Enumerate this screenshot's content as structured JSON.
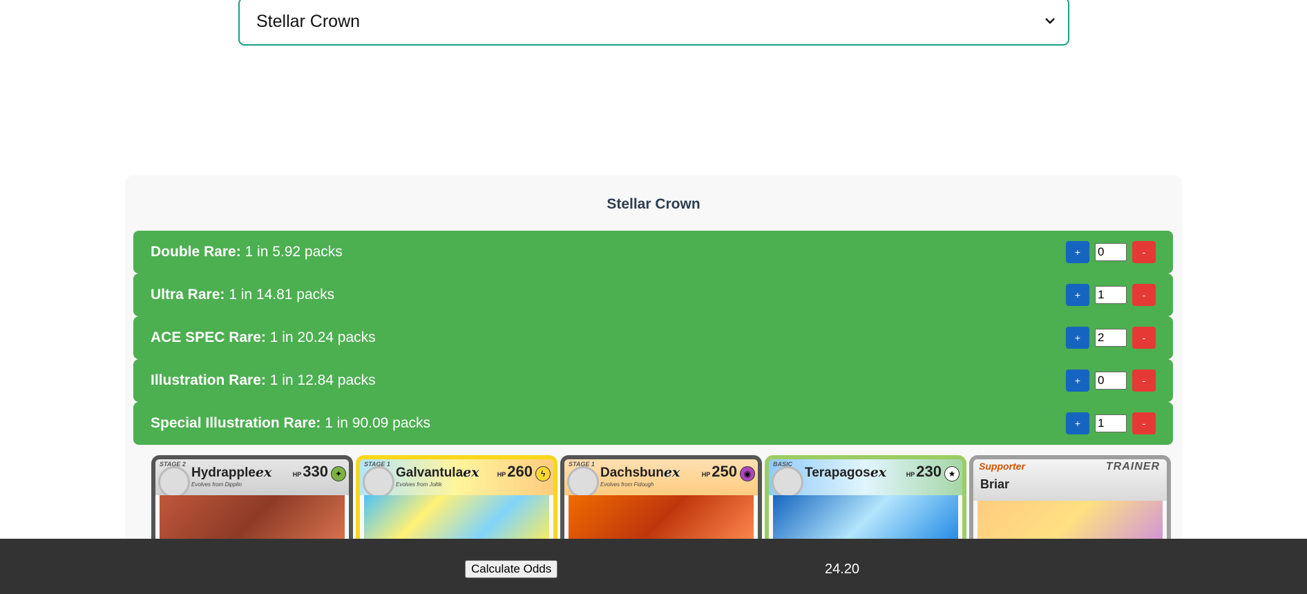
{
  "set_select": {
    "value": "Stellar Crown",
    "icon": "chevron-down-icon"
  },
  "panel": {
    "title": "Stellar Crown",
    "rarities": [
      {
        "name": "Double Rare:",
        "odds": " 1 in 5.92 packs",
        "count": "0"
      },
      {
        "name": "Ultra Rare:",
        "odds": " 1 in 14.81 packs",
        "count": "1"
      },
      {
        "name": "ACE SPEC Rare:",
        "odds": " 1 in 20.24 packs",
        "count": "2"
      },
      {
        "name": "Illustration Rare:",
        "odds": " 1 in 12.84 packs",
        "count": "0"
      },
      {
        "name": "Special Illustration Rare:",
        "odds": " 1 in 90.09 packs",
        "count": "1"
      }
    ],
    "plus_label": "+",
    "minus_label": "-"
  },
  "cards": [
    {
      "stage": "STAGE 2",
      "name": "Hydrapple",
      "suffix": "ex",
      "hp_label": "HP",
      "hp": "330",
      "evolves": "Evolves from Dipplin",
      "color": "#7cb342",
      "art": "#a5472f"
    },
    {
      "stage": "STAGE 1",
      "name": "Galvantula",
      "suffix": "ex",
      "hp_label": "HP",
      "hp": "260",
      "evolves": "Evolves from Joltik",
      "color": "#fdd835",
      "art": "#4fc3f7"
    },
    {
      "stage": "STAGE 1",
      "name": "Dachsbun",
      "suffix": "ex",
      "hp_label": "HP",
      "hp": "250",
      "evolves": "Evolves from Fidough",
      "color": "#8e24aa",
      "art": "#e65100"
    },
    {
      "stage": "BASIC",
      "name": "Terapagos",
      "suffix": "ex",
      "hp_label": "HP",
      "hp": "230",
      "evolves": "",
      "color": "#bdbdbd",
      "art": "#1e88e5"
    },
    {
      "trainer_type": "Supporter",
      "trainer_label": "TRAINER",
      "name": "Briar",
      "art": "#ffb74d"
    }
  ],
  "footer": {
    "button_label": "Calculate Odds",
    "result": "24.20"
  }
}
